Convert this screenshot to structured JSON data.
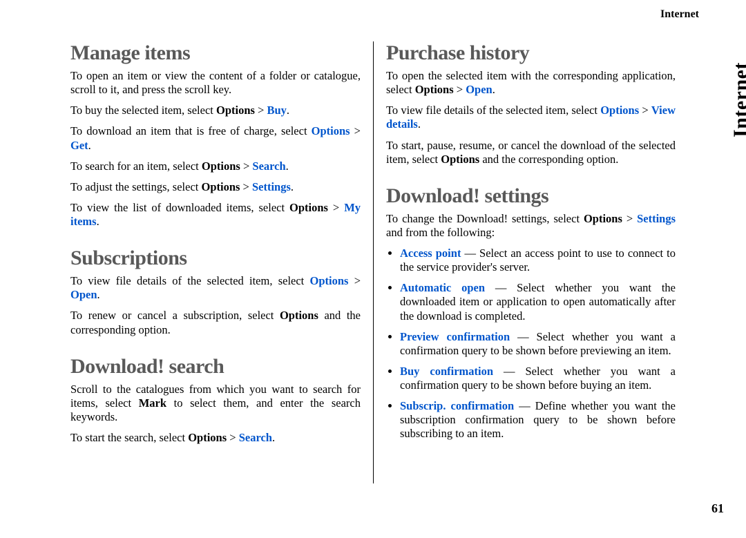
{
  "chapter": "Internet",
  "side_tab": "Internet",
  "page_number": "61",
  "left": {
    "h_manage": "Manage items",
    "p_manage_1a": "To open an item or view the content of a folder or catalogue, scroll to it, and press the scroll key.",
    "p_manage_2a": "To buy the selected item, select ",
    "p_manage_2b": "Options",
    "p_manage_2c": " > ",
    "p_manage_2d": "Buy",
    "p_manage_2e": ".",
    "p_manage_3a": "To download an item that is free of charge, select ",
    "p_manage_3b": "Options",
    "p_manage_3c": " > ",
    "p_manage_3d": "Get",
    "p_manage_3e": ".",
    "p_manage_4a": "To search for an item, select ",
    "p_manage_4b": "Options",
    "p_manage_4c": " > ",
    "p_manage_4d": "Search",
    "p_manage_4e": ".",
    "p_manage_5a": "To adjust the settings, select ",
    "p_manage_5b": "Options",
    "p_manage_5c": " > ",
    "p_manage_5d": "Settings",
    "p_manage_5e": ".",
    "p_manage_6a": "To view the list of downloaded items, select ",
    "p_manage_6b": "Options",
    "p_manage_6c": " > ",
    "p_manage_6d": "My items",
    "p_manage_6e": ".",
    "h_subs": "Subscriptions",
    "p_subs_1a": "To view file details of the selected item, select ",
    "p_subs_1b": "Options",
    "p_subs_1c": " > ",
    "p_subs_1d": "Open",
    "p_subs_1e": ".",
    "p_subs_2a": "To renew or cancel a subscription, select ",
    "p_subs_2b": "Options",
    "p_subs_2c": " and the corresponding option.",
    "h_dlsearch": "Download! search",
    "p_dls_1a": "Scroll to the catalogues from which you want to search for items, select ",
    "p_dls_1b": "Mark",
    "p_dls_1c": " to select them, and enter the search keywords.",
    "p_dls_2a": "To start the search, select ",
    "p_dls_2b": "Options",
    "p_dls_2c": " > ",
    "p_dls_2d": "Search",
    "p_dls_2e": "."
  },
  "right": {
    "h_purchase": "Purchase history",
    "p_ph_1a": "To open the selected item with the corresponding application, select ",
    "p_ph_1b": "Options",
    "p_ph_1c": " > ",
    "p_ph_1d": "Open",
    "p_ph_1e": ".",
    "p_ph_2a": "To view file details of the selected item, select ",
    "p_ph_2b": "Options",
    "p_ph_2c": " > ",
    "p_ph_2d": "View details",
    "p_ph_2e": ".",
    "p_ph_3a": "To start, pause, resume, or cancel the download of the selected item, select ",
    "p_ph_3b": "Options",
    "p_ph_3c": " and the corresponding option.",
    "h_dlset": "Download! settings",
    "p_ds_1a": "To change the Download! settings, select ",
    "p_ds_1b": "Options",
    "p_ds_1c": " > ",
    "p_ds_1d": "Settings",
    "p_ds_1e": " and from the following:",
    "li1_a": "Access point",
    "li1_b": " — Select an access point to use to connect to the service provider's server.",
    "li2_a": "Automatic open",
    "li2_b": " — Select whether you want the downloaded item or application to open automatically after the download is completed.",
    "li3_a": "Preview confirmation",
    "li3_b": " — Select whether you want a confirmation query to be shown before previewing an item.",
    "li4_a": "Buy confirmation",
    "li4_b": " — Select whether you want a confirmation query to be shown before buying an item.",
    "li5_a": "Subscrip. confirmation",
    "li5_b": " — Define whether you want the subscription confirmation query to be shown before subscribing to an item."
  }
}
